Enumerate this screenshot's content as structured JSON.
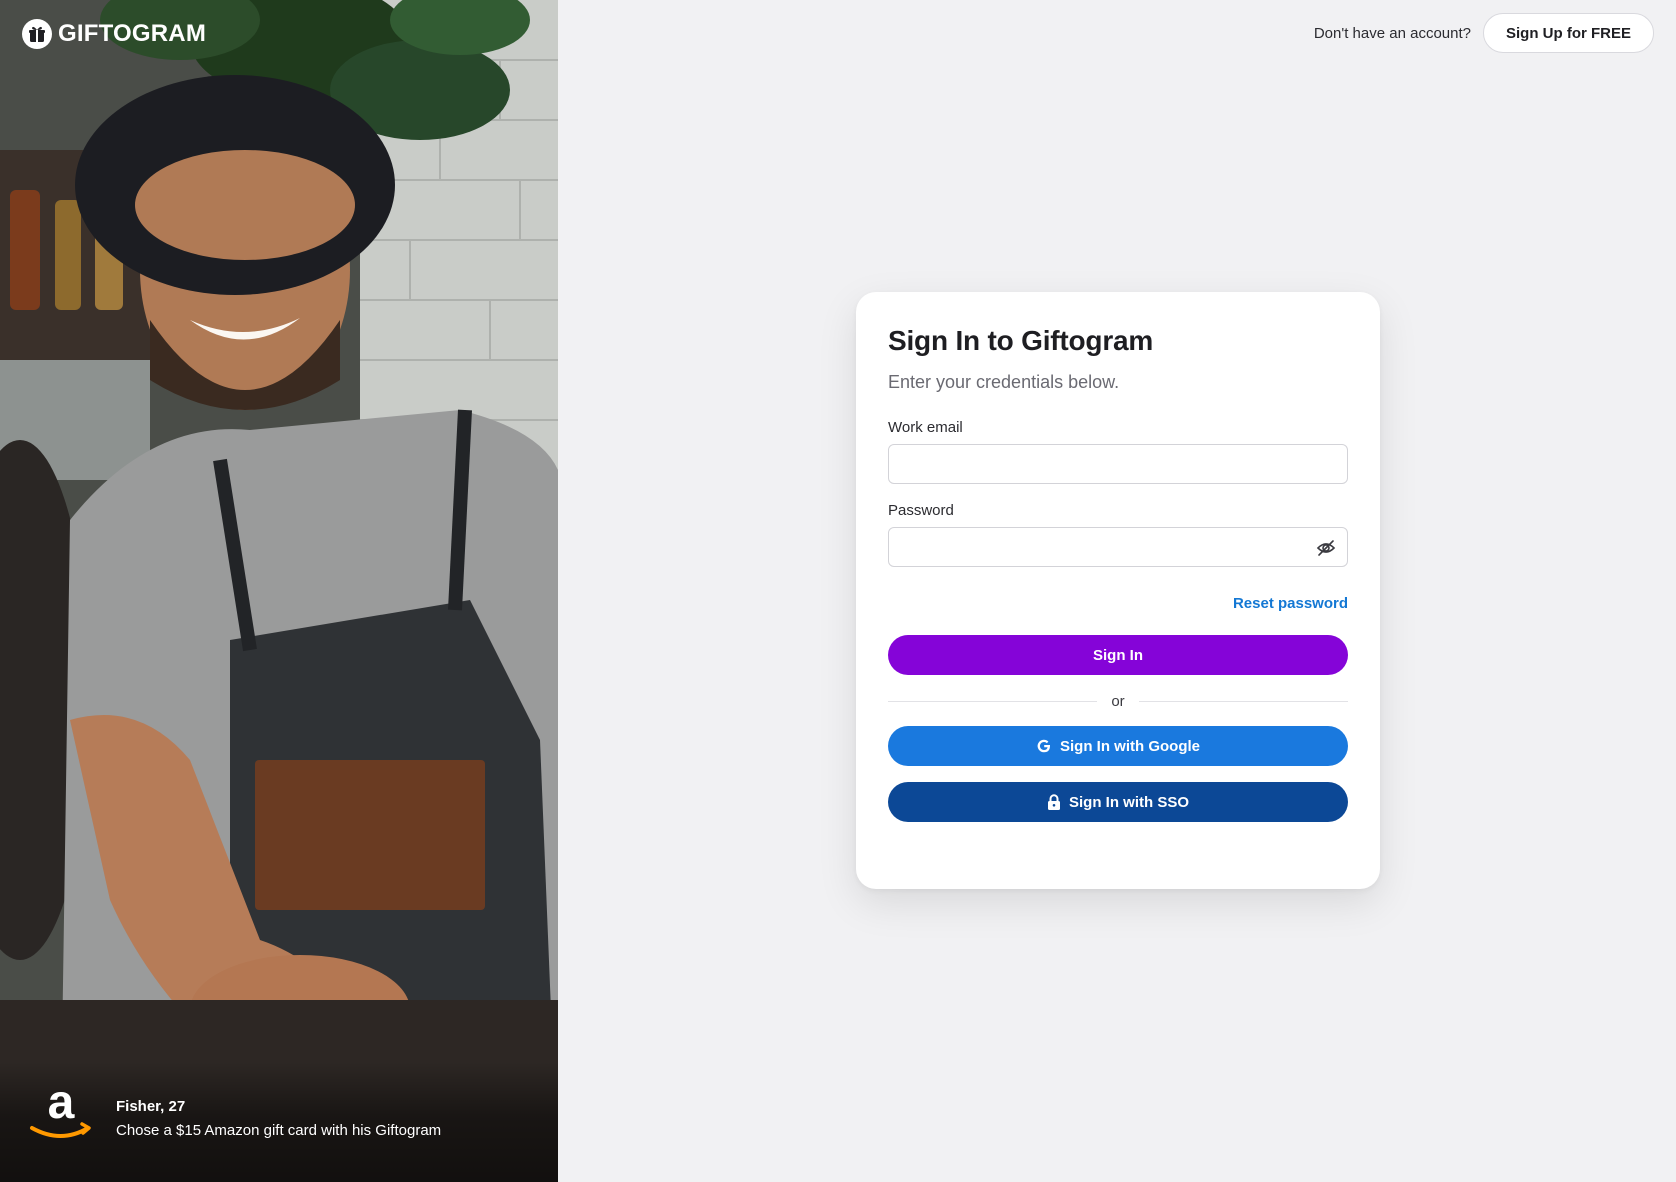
{
  "brand": {
    "name": "GIFTOGRAM"
  },
  "topbar": {
    "prompt": "Don't have an account?",
    "signup_label": "Sign Up for FREE"
  },
  "card": {
    "title": "Sign In to Giftogram",
    "subtitle": "Enter your credentials below.",
    "email_label": "Work email",
    "email_value": "",
    "password_label": "Password",
    "password_value": "",
    "reset_label": "Reset password",
    "signin_label": "Sign In",
    "or_label": "or",
    "google_label": "Sign In with Google",
    "sso_label": "Sign In with SSO"
  },
  "testimonial": {
    "name": "Fisher, 27",
    "description": "Chose a $15 Amazon gift card with his Giftogram"
  },
  "colors": {
    "primary_purple": "#8504d8",
    "google_blue": "#1a79de",
    "sso_navy": "#0c4896",
    "link_blue": "#1478d4",
    "page_bg": "#f1f1f3"
  },
  "icons": [
    "gift-icon",
    "eye-off-icon",
    "google-g-icon",
    "lock-icon",
    "amazon-logo"
  ]
}
